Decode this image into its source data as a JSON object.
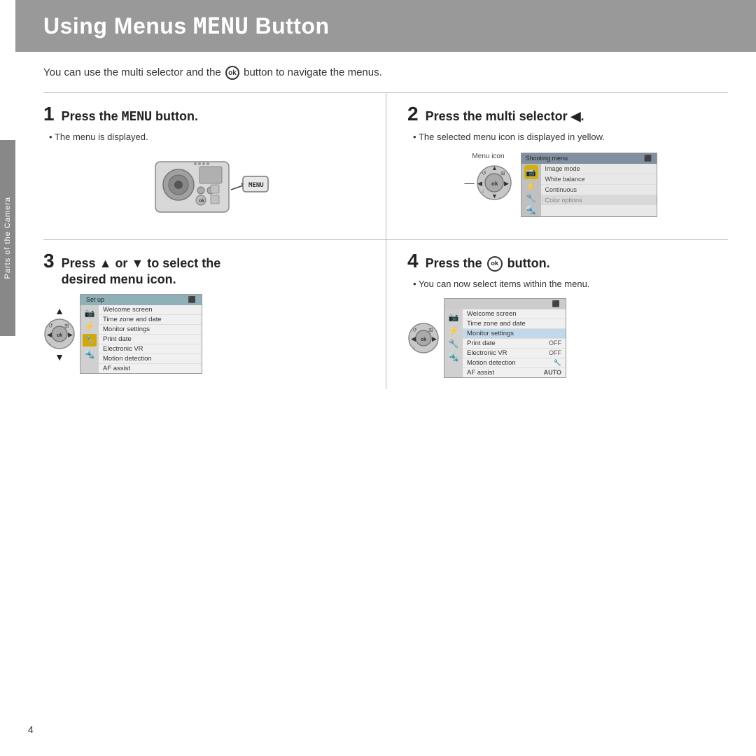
{
  "header": {
    "title": "Using Menus (",
    "title_menu": "MENU",
    "title_end": " Button)"
  },
  "intro": {
    "text_before": "You can use the multi selector and the ",
    "ok_label": "ok",
    "text_after": " button to navigate the menus."
  },
  "side_tab": {
    "label": "Parts of the Camera"
  },
  "steps": [
    {
      "number": "1",
      "title_before": "Press the ",
      "title_mono": "MENU",
      "title_after": " button.",
      "bullet": "The menu is displayed."
    },
    {
      "number": "2",
      "title": "Press the multi selector ◀.",
      "bullet": "The selected menu icon is displayed in yellow."
    },
    {
      "number": "3",
      "title_before": "Press ▲ or ▼ to select the",
      "title_line2": "desired menu icon."
    },
    {
      "number": "4",
      "title_before": "Press the ",
      "title_ok": "ok",
      "title_after": " button.",
      "bullet": "You can now select items within the menu."
    }
  ],
  "step2_menu": {
    "header": "Shooting menu",
    "menu_icon_label": "Menu icon",
    "items": [
      {
        "icon": "📷",
        "label": "Image mode",
        "highlight": false
      },
      {
        "icon": "",
        "label": "White balance",
        "highlight": false
      },
      {
        "icon": "",
        "label": "Continuous",
        "highlight": false
      },
      {
        "icon": "🎨",
        "label": "Color options",
        "highlight": false
      }
    ]
  },
  "step3_menu": {
    "header": "Set up",
    "items": [
      {
        "label": "Welcome screen",
        "value": "",
        "active": false
      },
      {
        "label": "Time zone and date",
        "value": "",
        "active": false
      },
      {
        "label": "Monitor settings",
        "value": "",
        "active": false
      },
      {
        "label": "Print date",
        "value": "",
        "active": false
      },
      {
        "label": "Electronic VR",
        "value": "",
        "active": false
      },
      {
        "label": "Motion detection",
        "value": "",
        "active": false
      },
      {
        "label": "AF assist",
        "value": "",
        "active": false
      }
    ]
  },
  "step4_menu": {
    "header": "",
    "items": [
      {
        "label": "Welcome screen",
        "value": "",
        "active": false
      },
      {
        "label": "Time zone and date",
        "value": "",
        "active": false
      },
      {
        "label": "Monitor settings",
        "value": "",
        "active": true
      },
      {
        "label": "Print date",
        "value": "OFF",
        "active": false
      },
      {
        "label": "Electronic VR",
        "value": "OFF",
        "active": false
      },
      {
        "label": "Motion detection",
        "value": "🔧",
        "active": false
      },
      {
        "label": "AF assist",
        "value": "AUTO",
        "active": false
      }
    ]
  },
  "page_number": "4"
}
